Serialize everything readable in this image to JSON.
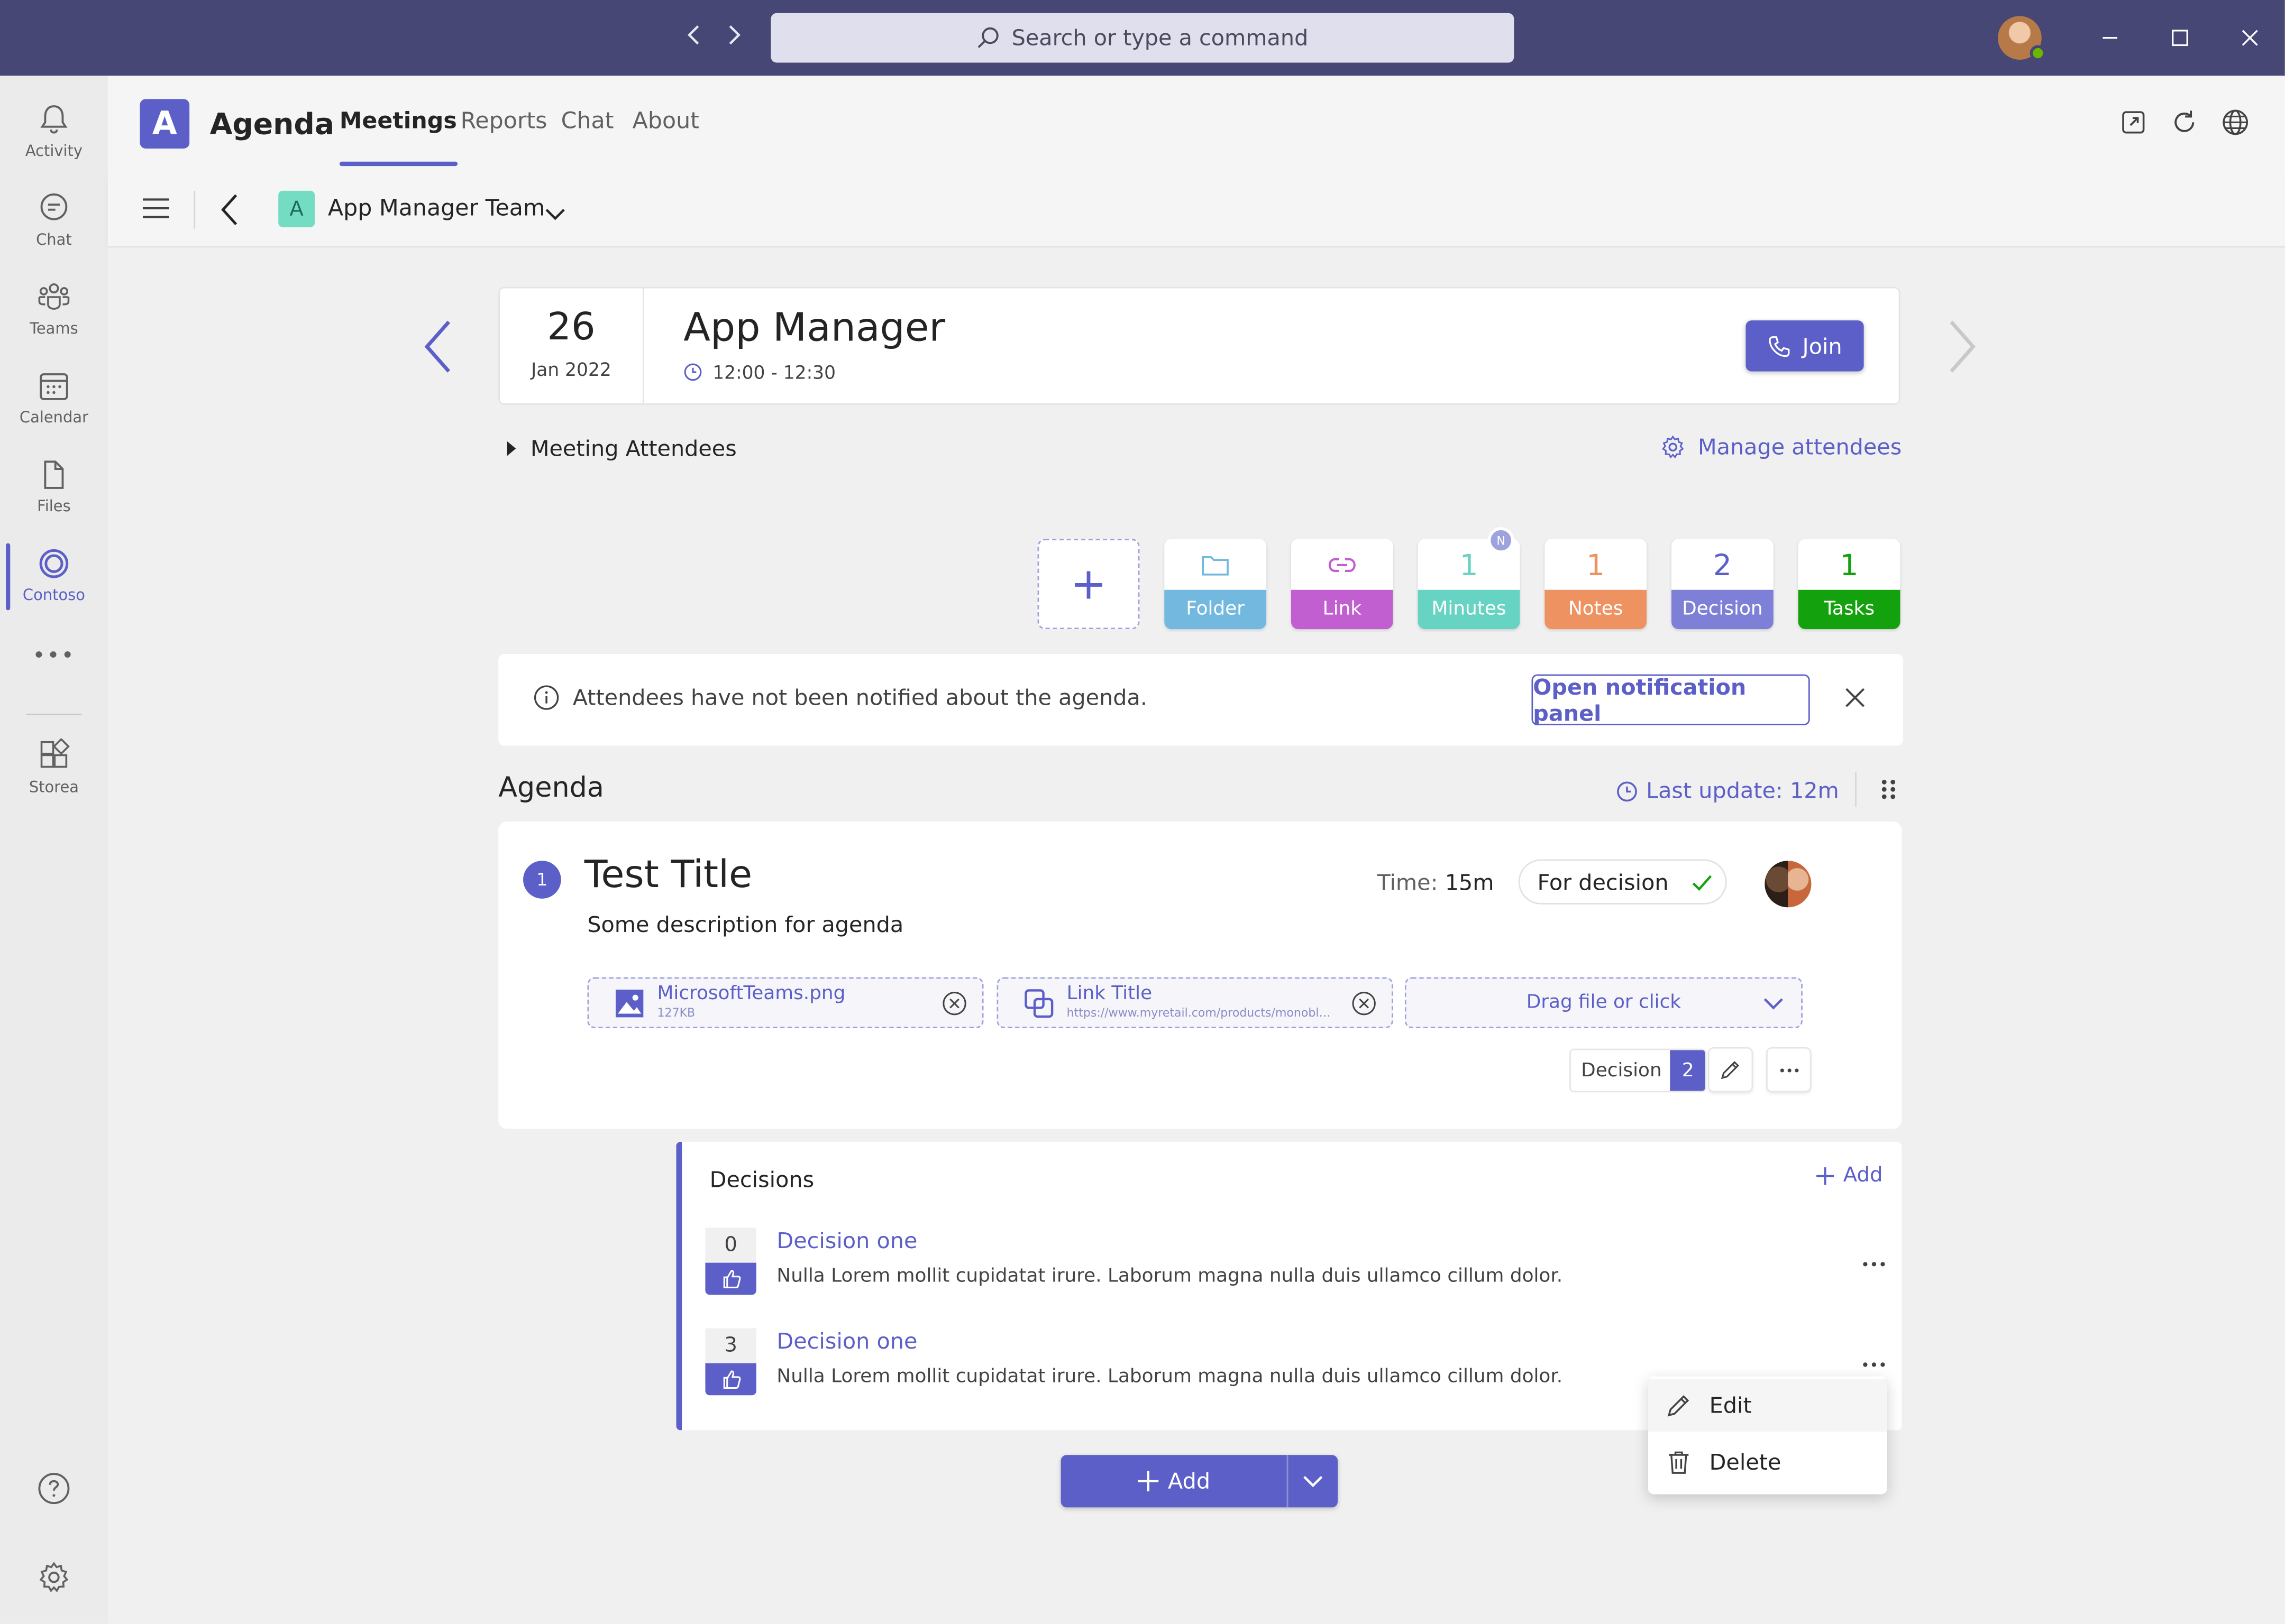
{
  "titlebar": {
    "search_placeholder": "Search or type a command"
  },
  "rail": {
    "items": [
      {
        "label": "Activity",
        "icon": "bell-icon"
      },
      {
        "label": "Chat",
        "icon": "chat-icon"
      },
      {
        "label": "Teams",
        "icon": "teams-icon"
      },
      {
        "label": "Calendar",
        "icon": "calendar-icon"
      },
      {
        "label": "Files",
        "icon": "file-icon"
      },
      {
        "label": "Contoso",
        "icon": "contoso-icon"
      },
      {
        "label": "Storea",
        "icon": "apps-icon"
      }
    ],
    "more_label": "•••"
  },
  "header": {
    "app_letter": "A",
    "app_name": "Agenda",
    "tabs": [
      {
        "label": "Meetings",
        "active": true
      },
      {
        "label": "Reports"
      },
      {
        "label": "Chat"
      },
      {
        "label": "About"
      }
    ]
  },
  "subbar": {
    "team_letter": "A",
    "team_name": "App Manager Team"
  },
  "meeting": {
    "day": "26",
    "month_year": "Jan 2022",
    "title": "App Manager",
    "time": "12:00 - 12:30",
    "join_label": "Join"
  },
  "attendees": {
    "toggle_label": "Meeting Attendees",
    "manage_label": "Manage attendees"
  },
  "tiles": [
    {
      "value": "",
      "label": "Folder",
      "icon": "folder-icon",
      "color": "#72b8df"
    },
    {
      "value": "",
      "label": "Link",
      "icon": "link-icon",
      "color": "#c25fd0"
    },
    {
      "value": "1",
      "label": "Minutes",
      "icon": "",
      "color": "#67d3c2"
    },
    {
      "value": "1",
      "label": "Notes",
      "icon": "",
      "color": "#ef9262"
    },
    {
      "value": "2",
      "label": "Decision",
      "icon": "",
      "color": "#7e7fd6"
    },
    {
      "value": "1",
      "label": "Tasks",
      "icon": "",
      "color": "#13a10e"
    }
  ],
  "notice": {
    "text": "Attendees have not been notified about the agenda.",
    "button_label": "Open notification panel"
  },
  "agenda": {
    "heading": "Agenda",
    "last_update": "Last update: 12m",
    "item": {
      "number": "1",
      "title": "Test Title",
      "description": "Some description for agenda",
      "time_label": "Time:",
      "time_value": "15m",
      "status": "For decision",
      "attachments": [
        {
          "name": "MicrosoftTeams.png",
          "sub": "127KB",
          "icon": "image-icon"
        },
        {
          "name": "Link Title",
          "sub": "https://www.myretail.com/products/monoblok-",
          "icon": "link-copy-icon"
        }
      ],
      "drop_label": "Drag file or click",
      "decision_pill_label": "Decision",
      "decision_pill_count": "2"
    }
  },
  "decisions": {
    "heading": "Decisions",
    "add_label": "Add",
    "items": [
      {
        "votes": "0",
        "title": "Decision one",
        "text": "Nulla Lorem mollit cupidatat irure. Laborum magna nulla duis ullamco cillum dolor."
      },
      {
        "votes": "3",
        "title": "Decision one",
        "text": "Nulla Lorem mollit cupidatat irure. Laborum magna nulla duis ullamco cillum dolor."
      }
    ]
  },
  "context_menu": {
    "items": [
      {
        "label": "Edit",
        "icon": "pencil-icon"
      },
      {
        "label": "Delete",
        "icon": "trash-icon"
      }
    ]
  },
  "footer_add_label": "Add",
  "colors": {
    "titlebar": "#464775",
    "brand": "#5b5fc7"
  }
}
